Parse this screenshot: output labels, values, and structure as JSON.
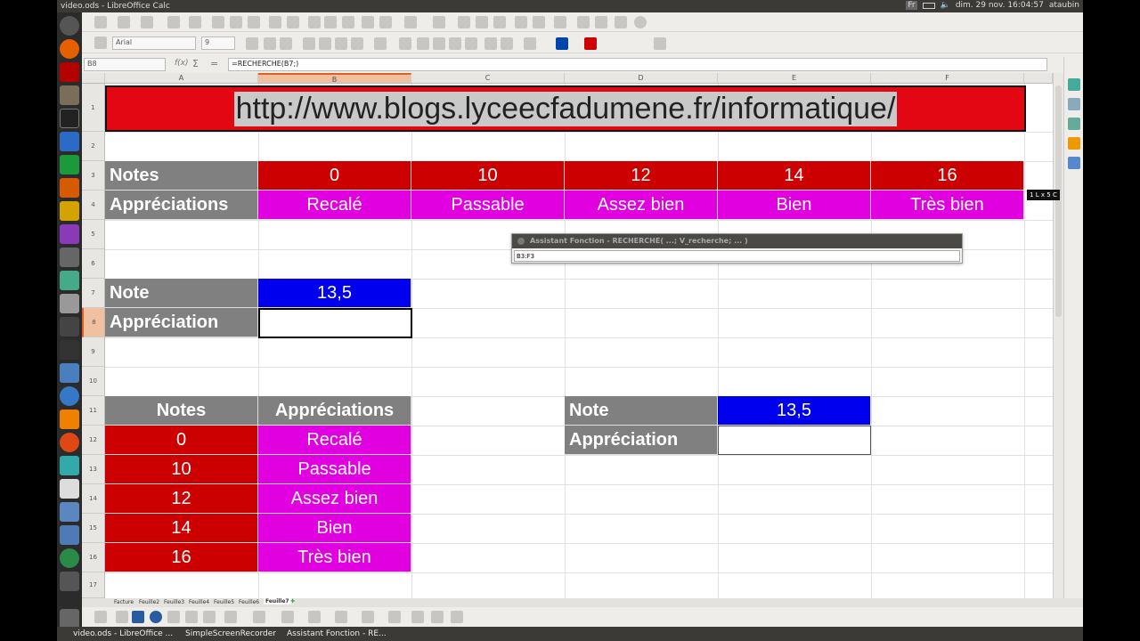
{
  "window": {
    "title": "video.ods - LibreOffice Calc",
    "clock": "dim. 29 nov. 16:04:57",
    "user": "ataubin",
    "lang": "Fr"
  },
  "toolbar": {
    "font_name": "Arial",
    "font_size": "9"
  },
  "formula_bar": {
    "name_box": "B8",
    "formula": "=RECHERCHE(B7;)"
  },
  "columns": [
    "A",
    "B",
    "C",
    "D",
    "E",
    "F"
  ],
  "rows": [
    "1",
    "2",
    "3",
    "4",
    "5",
    "6",
    "7",
    "8",
    "9",
    "10",
    "11",
    "12",
    "13",
    "14",
    "15",
    "16",
    "17"
  ],
  "sheet": {
    "url_banner": "http://www.blogs.lyceecfadumene.fr/informatique/",
    "top_table": {
      "notes_label": "Notes",
      "appreciations_label": "Appréciations",
      "notes": [
        "0",
        "10",
        "12",
        "14",
        "16"
      ],
      "appreciations": [
        "Recalé",
        "Passable",
        "Assez bien",
        "Bien",
        "Très bien"
      ]
    },
    "input": {
      "note_label": "Note",
      "note_value": "13,5",
      "appreciation_label": "Appréciation"
    },
    "bottom_table": {
      "header_notes": "Notes",
      "header_appreciations": "Appréciations",
      "rows": [
        {
          "note": "0",
          "appr": "Recalé"
        },
        {
          "note": "10",
          "appr": "Passable"
        },
        {
          "note": "12",
          "appr": "Assez bien"
        },
        {
          "note": "14",
          "appr": "Bien"
        },
        {
          "note": "16",
          "appr": "Très bien"
        }
      ]
    },
    "right_input": {
      "note_label": "Note",
      "note_value": "13,5",
      "appreciation_label": "Appréciation"
    }
  },
  "function_wizard": {
    "title": "Assistant Fonction - RECHERCHE( ...; V_recherche; ... )",
    "input_value": "B3:F3"
  },
  "tooltip": "1 L x 5 C",
  "sheet_tabs": [
    "Facture",
    "Feuille2",
    "Feuille3",
    "Feuille4",
    "Feuille5",
    "Feuille6",
    "Feuille7"
  ],
  "active_tab": "Feuille7",
  "taskbar": {
    "items": [
      "video.ods - LibreOffice ...",
      "SimpleScreenRecorder",
      "Assistant Fonction - RE..."
    ]
  },
  "colors": {
    "red": "#cc0000",
    "banner_red": "#e30613",
    "magenta": "#e000e0",
    "grey": "#808080",
    "blue": "#0000ee"
  }
}
